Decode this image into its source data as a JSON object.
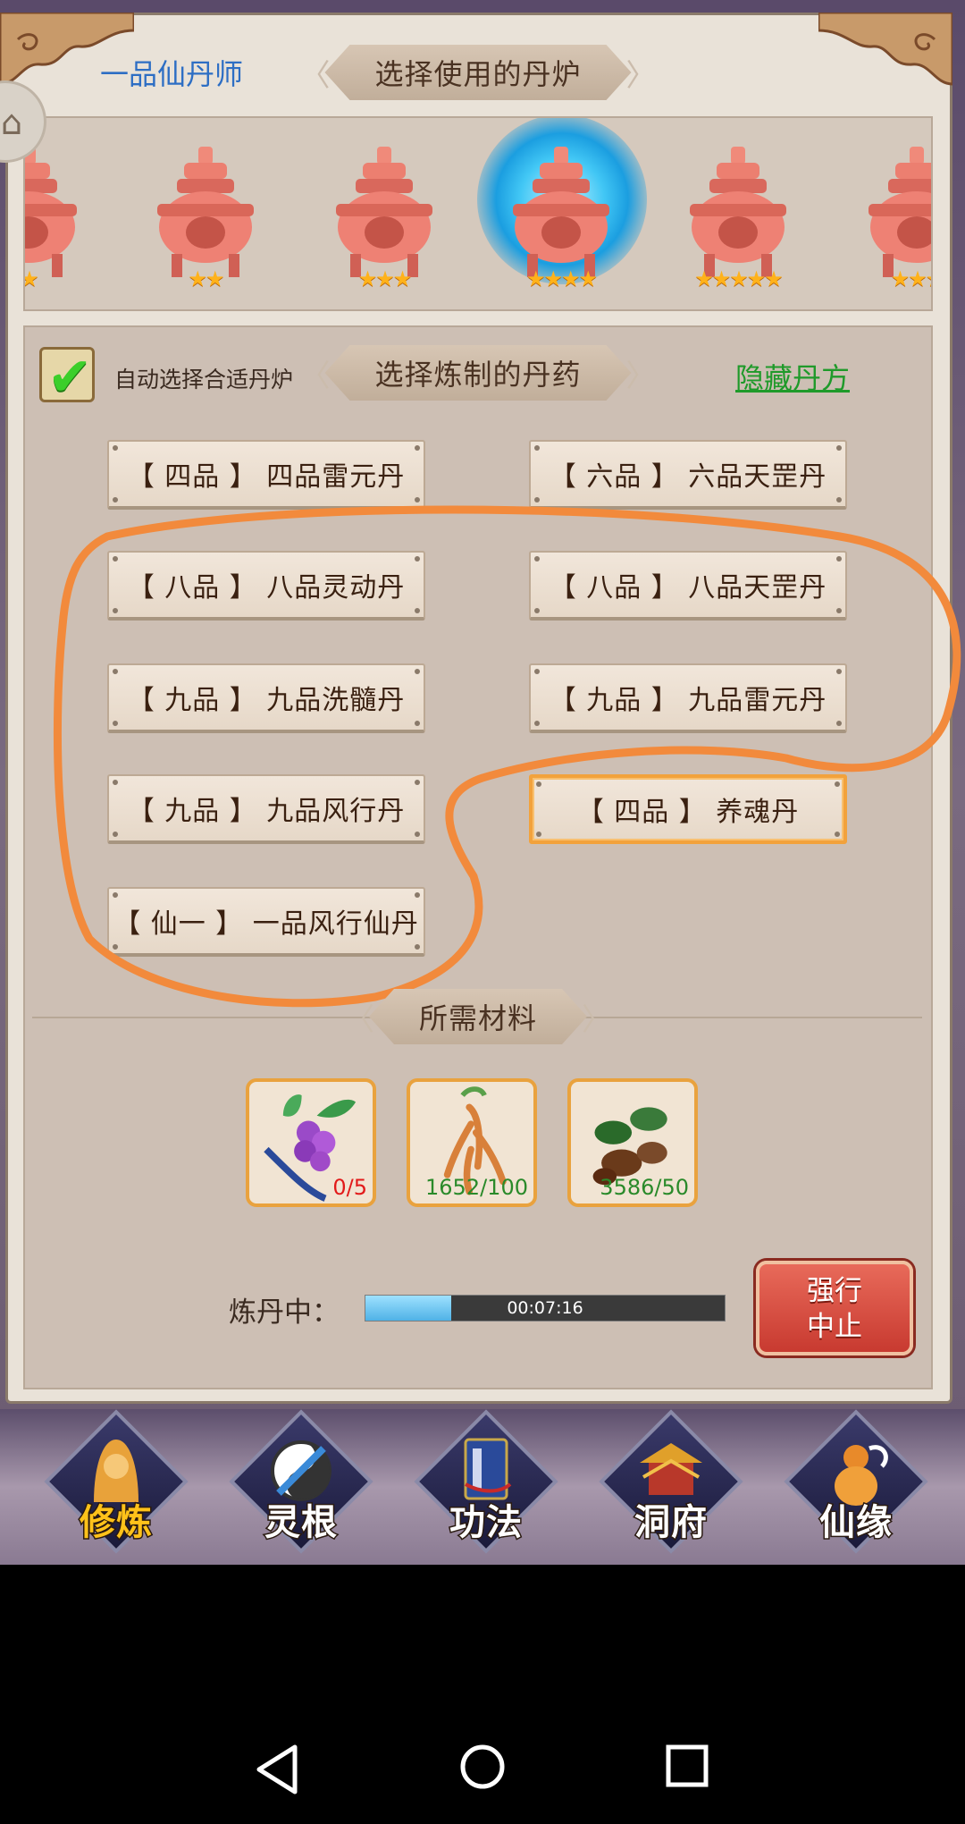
{
  "header": {
    "rank": "一品仙丹师",
    "furnace_title": "选择使用的丹炉"
  },
  "furnaces": [
    {
      "stars": "★",
      "selected": false
    },
    {
      "stars": "★★",
      "selected": false
    },
    {
      "stars": "★★★",
      "selected": false
    },
    {
      "stars": "★★★★",
      "selected": true
    },
    {
      "stars": "★★★★★",
      "selected": false
    },
    {
      "stars": "★★★",
      "selected": false
    }
  ],
  "recipe_section": {
    "auto_select_label": "自动选择合适丹炉",
    "title": "选择炼制的丹药",
    "hide_link": "隐藏丹方",
    "auto_checked": true
  },
  "recipes": [
    {
      "label": "【 四品 】 四品雷元丹",
      "selected": false
    },
    {
      "label": "【 六品 】 六品天罡丹",
      "selected": false
    },
    {
      "label": "【 八品 】 八品灵动丹",
      "selected": false
    },
    {
      "label": "【 八品 】 八品天罡丹",
      "selected": false
    },
    {
      "label": "【 九品 】 九品洗髓丹",
      "selected": false
    },
    {
      "label": "【 九品 】 九品雷元丹",
      "selected": false
    },
    {
      "label": "【 九品 】 九品风行丹",
      "selected": false
    },
    {
      "label": "【 四品 】 养魂丹",
      "selected": true
    },
    {
      "label": "【 仙一 】 一品风行仙丹",
      "selected": false
    }
  ],
  "materials": {
    "title": "所需材料",
    "items": [
      {
        "icon": "berry-herb-icon",
        "count": "0/5",
        "color": "red"
      },
      {
        "icon": "ginseng-icon",
        "count": "1652/100",
        "color": "green"
      },
      {
        "icon": "root-herb-icon",
        "count": "3586/50",
        "color": "green"
      }
    ]
  },
  "progress": {
    "label": "炼丹中：",
    "time": "00:07:16",
    "fraction": 0.24
  },
  "force_stop": {
    "line1": "强行",
    "line2": "中止"
  },
  "bottom_nav": [
    {
      "label": "修炼",
      "icon": "cultivator-icon",
      "active": true
    },
    {
      "label": "灵根",
      "icon": "spirit-root-icon",
      "active": false
    },
    {
      "label": "功法",
      "icon": "technique-book-icon",
      "active": false
    },
    {
      "label": "洞府",
      "icon": "cave-dwelling-icon",
      "active": false
    },
    {
      "label": "仙缘",
      "icon": "gourd-icon",
      "active": false
    }
  ],
  "system_nav": {
    "back": "back-icon",
    "home": "home-icon",
    "recents": "recents-icon"
  },
  "colors": {
    "accent_orange": "#f2a23c",
    "link_green": "#1f9a2a",
    "rank_blue": "#2d6ec4",
    "stop_red": "#c83a30"
  }
}
